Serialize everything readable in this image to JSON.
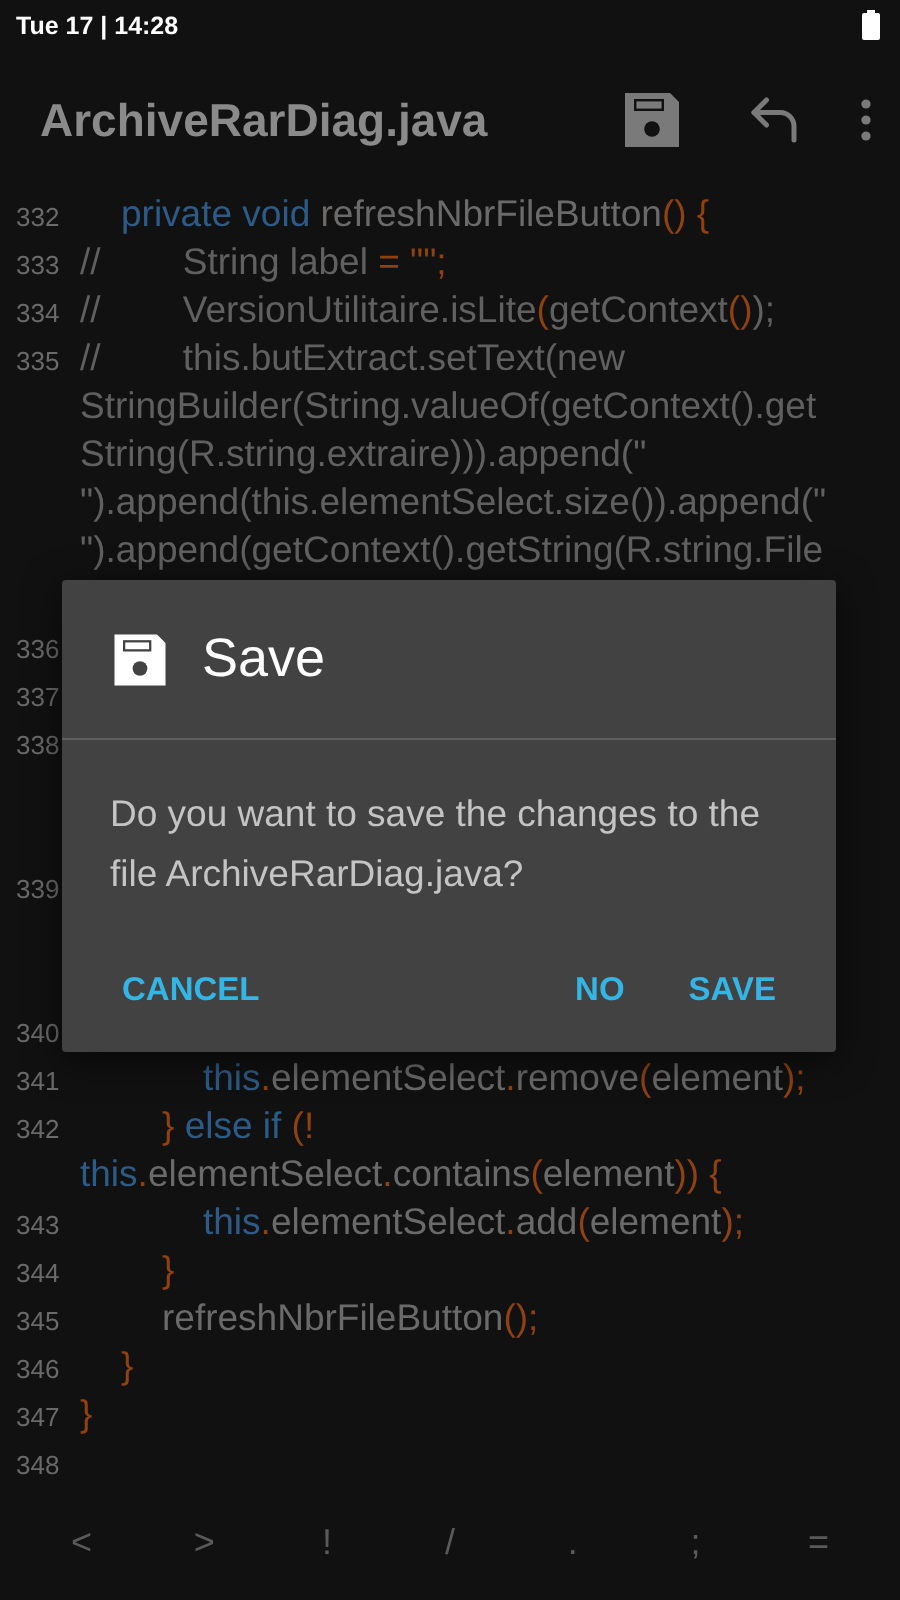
{
  "status_bar": {
    "time": "Tue 17 | 14:28"
  },
  "app_bar": {
    "title": "ArchiveRarDiag.java"
  },
  "editor": {
    "lines": [
      {
        "number": "332",
        "kind": "code",
        "rows": [
          {
            "kind": "indented",
            "tokens": [
              {
                "kind": "keyword",
                "text": "private void "
              },
              {
                "kind": "plain",
                "text": "refreshNbrFileButton"
              },
              {
                "kind": "punct",
                "text": "() {"
              }
            ]
          }
        ]
      },
      {
        "number": "333",
        "kind": "code",
        "rows": [
          {
            "tokens": [
              {
                "kind": "comment",
                "text": "//        String label "
              },
              {
                "kind": "punct",
                "text": "= \"\";"
              }
            ]
          }
        ]
      },
      {
        "number": "334",
        "kind": "code",
        "rows": [
          {
            "tokens": [
              {
                "kind": "comment",
                "text": "//        VersionUtilitaire.isLite"
              },
              {
                "kind": "punct",
                "text": "("
              },
              {
                "kind": "comment",
                "text": "getContext"
              },
              {
                "kind": "punct",
                "text": "()"
              },
              {
                "kind": "comment",
                "text": ");"
              }
            ]
          }
        ]
      },
      {
        "number": "335",
        "kind": "code-cut",
        "rows": [
          {
            "tokens": [
              {
                "kind": "comment",
                "text": "//        this.butExtract.setText(new"
              }
            ]
          },
          {
            "tokens": [
              {
                "kind": "comment",
                "text": "StringBuilder(String.valueOf(getContext().get"
              }
            ]
          },
          {
            "tokens": [
              {
                "kind": "comment",
                "text": "String(R.string.extraire))).append(\""
              }
            ]
          },
          {
            "tokens": [
              {
                "kind": "comment",
                "text": "\").append(this.elementSelect.size()).append(\""
              }
            ]
          },
          {
            "tokens": [
              {
                "kind": "comment",
                "text": "\").append(getContext().getString(R.string.File"
              }
            ]
          }
        ]
      },
      {
        "number": "336",
        "kind": "covered"
      },
      {
        "number": "337",
        "kind": "covered"
      },
      {
        "number": "338",
        "kind": "covered-tall"
      },
      {
        "number": "339",
        "kind": "covered-tall"
      },
      {
        "number": "340",
        "kind": "covered"
      },
      {
        "number": "341",
        "kind": "code",
        "rows": [
          {
            "kind": "deep",
            "tokens": [
              {
                "kind": "keyword",
                "text": "this"
              },
              {
                "kind": "punct",
                "text": "."
              },
              {
                "kind": "plain",
                "text": "elementSelect"
              },
              {
                "kind": "punct",
                "text": "."
              },
              {
                "kind": "plain",
                "text": "remove"
              },
              {
                "kind": "punct",
                "text": "("
              },
              {
                "kind": "plain",
                "text": "element"
              },
              {
                "kind": "punct",
                "text": ");"
              }
            ]
          }
        ]
      },
      {
        "number": "342",
        "kind": "code",
        "rows": [
          {
            "kind": "nested",
            "tokens": [
              {
                "kind": "punct",
                "text": "} "
              },
              {
                "kind": "keyword",
                "text": "else if "
              },
              {
                "kind": "punct",
                "text": "(!"
              }
            ]
          },
          {
            "tokens": [
              {
                "kind": "keyword",
                "text": "this"
              },
              {
                "kind": "punct",
                "text": "."
              },
              {
                "kind": "plain",
                "text": "elementSelect"
              },
              {
                "kind": "punct",
                "text": "."
              },
              {
                "kind": "plain",
                "text": "contains"
              },
              {
                "kind": "punct",
                "text": "("
              },
              {
                "kind": "plain",
                "text": "element"
              },
              {
                "kind": "punct",
                "text": ")) {"
              }
            ]
          }
        ]
      },
      {
        "number": "343",
        "kind": "code",
        "rows": [
          {
            "kind": "deep",
            "tokens": [
              {
                "kind": "keyword",
                "text": "this"
              },
              {
                "kind": "punct",
                "text": "."
              },
              {
                "kind": "plain",
                "text": "elementSelect"
              },
              {
                "kind": "punct",
                "text": "."
              },
              {
                "kind": "plain",
                "text": "add"
              },
              {
                "kind": "punct",
                "text": "("
              },
              {
                "kind": "plain",
                "text": "element"
              },
              {
                "kind": "punct",
                "text": ");"
              }
            ]
          }
        ]
      },
      {
        "number": "344",
        "kind": "code",
        "rows": [
          {
            "kind": "nested",
            "tokens": [
              {
                "kind": "punct",
                "text": "}"
              }
            ]
          }
        ]
      },
      {
        "number": "345",
        "kind": "code",
        "rows": [
          {
            "kind": "nested",
            "tokens": [
              {
                "kind": "plain",
                "text": "refreshNbrFileButton"
              },
              {
                "kind": "punct",
                "text": "();"
              }
            ]
          }
        ]
      },
      {
        "number": "346",
        "kind": "code",
        "rows": [
          {
            "kind": "indented",
            "tokens": [
              {
                "kind": "punct",
                "text": "}"
              }
            ]
          }
        ]
      },
      {
        "number": "347",
        "kind": "code",
        "rows": [
          {
            "tokens": [
              {
                "kind": "punct",
                "text": "}"
              }
            ]
          }
        ]
      },
      {
        "number": "348",
        "kind": "empty"
      }
    ]
  },
  "symbol_bar": [
    "<",
    ">",
    "!",
    "/",
    ".",
    ";",
    "="
  ],
  "dialog": {
    "title": "Save",
    "message": "Do you want to save the changes to the file ArchiveRarDiag.java?",
    "buttons": [
      "CANCEL",
      "NO",
      "SAVE"
    ]
  }
}
